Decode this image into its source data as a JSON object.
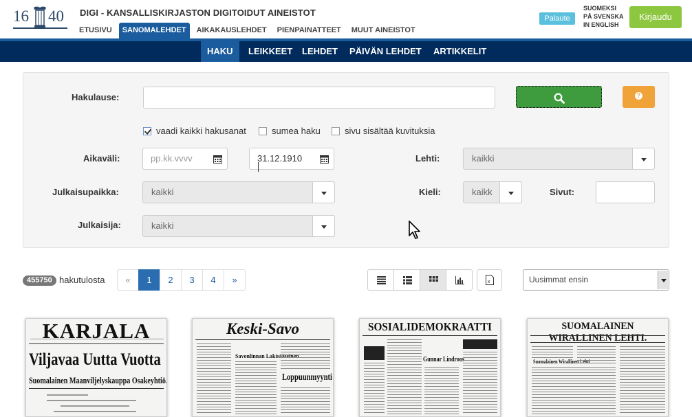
{
  "header": {
    "logo_left": "16",
    "logo_right": "40",
    "site_title": "DIGI - KANSALLISKIRJASTON DIGITOIDUT AINEISTOT",
    "nav": [
      "ETUSIVU",
      "SANOMALEHDET",
      "AIKAKAUSLEHDET",
      "PIENPAINATTEET",
      "MUUT AINEISTOT"
    ],
    "feedback_label": "Palaute",
    "languages": [
      "SUOMEKSI",
      "PÅ SVENSKA",
      "IN ENGLISH"
    ],
    "login_label": "Kirjaudu"
  },
  "subnav": [
    "HAKU",
    "LEIKKEET",
    "LEHDET",
    "PÄIVÄN LEHDET",
    "ARTIKKELIT"
  ],
  "search": {
    "query_label": "Hakulause:",
    "query_value": "",
    "search_icon": "search-icon",
    "help_icon": "question-icon",
    "checkboxes": [
      {
        "label": "vaadi kaikki hakusanat",
        "checked": true
      },
      {
        "label": "sumea haku",
        "checked": false
      },
      {
        "label": "sivu sisältää kuvituksia",
        "checked": false
      }
    ],
    "date_label": "Aikaväli:",
    "date_start_placeholder": "pp.kk.vvvv",
    "date_end_value": "31.12.1910",
    "paper_label": "Lehti:",
    "paper_value": "kaikki",
    "place_label": "Julkaisupaikka:",
    "place_value": "kaikki",
    "language_label": "Kieli:",
    "language_value": "kaikk",
    "pages_label": "Sivut:",
    "pages_value": "",
    "publisher_label": "Julkaisija:",
    "publisher_value": "kaikki"
  },
  "results": {
    "count": "455750",
    "count_label": "hakutulosta",
    "pages": [
      "«",
      "1",
      "2",
      "3",
      "4",
      "»"
    ],
    "current_page": "1",
    "view_modes": [
      "list-view",
      "compact-list-view",
      "grid-view",
      "chart-view"
    ],
    "active_view": "grid-view",
    "export_icon": "excel-export-icon",
    "sort_value": "Uusimmat ensin"
  },
  "thumbnails": [
    {
      "masthead": "KARJALA",
      "headline": "Viljavaa Uutta Vuotta",
      "subline": "Suomalainen Maanviljelyskauppa Osakeyhtiö."
    },
    {
      "masthead": "Keski-Savo",
      "headline": "Loppuunmyynti",
      "subline": "Savonlinnan Lakisääteinen"
    },
    {
      "masthead": "SOSIALIDEMOKRAATTI",
      "headline": "Gunnar Lindroos",
      "subline": ""
    },
    {
      "masthead": "SUOMALAINEN WIRALLINEN LEHTI.",
      "headline": "Suomalainen Wirallinen Lehti",
      "subline": ""
    }
  ],
  "colors": {
    "nav_dark": "#002b5c",
    "nav_active": "#1a5c9e",
    "search_green": "#3e9b3e",
    "help_orange": "#f0a338",
    "login_green": "#8dc63f",
    "feedback_blue": "#5bc0de"
  }
}
